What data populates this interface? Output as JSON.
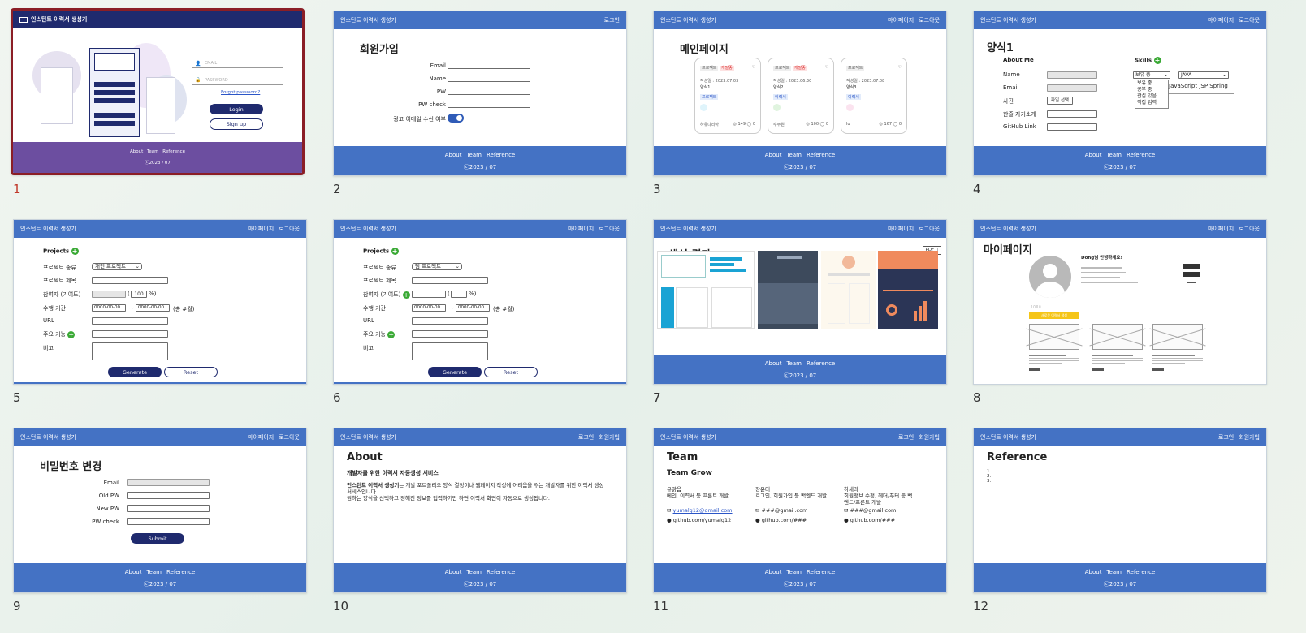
{
  "common": {
    "app_title": "인스턴트 이력서 생성기",
    "nav_mypage": "마이페이지",
    "nav_logout": "로그아웃",
    "nav_login": "로그인",
    "nav_signup": "회원가입",
    "footer_about": "About",
    "footer_team": "Team",
    "footer_reference": "Reference",
    "footer_copy": "ⓒ2023 / 07"
  },
  "slide_numbers": [
    "1",
    "2",
    "3",
    "4",
    "5",
    "6",
    "7",
    "8",
    "9",
    "10",
    "11",
    "12"
  ],
  "s1": {
    "email_placeholder": "EMAIL",
    "password_placeholder": "PASSWORD",
    "forgot": "Forgot password?",
    "login": "Login",
    "signup": "Sign up"
  },
  "s2": {
    "title": "회원가입",
    "email": "Email",
    "name": "Name",
    "pw": "PW",
    "pw_check": "PW check",
    "ad_consent": "광고 이메일 수신 여부"
  },
  "s3": {
    "title": "메인페이지",
    "cards": [
      {
        "tag1": "프로젝트",
        "tag2": "개발중",
        "date": "작성일 : 2023.07.03",
        "name": "양식1",
        "label": "프로젝트",
        "user": "하유나리아",
        "stats": "◎ 149  ◯ 0"
      },
      {
        "tag1": "프로젝트",
        "tag2": "개발중",
        "date": "작성일 : 2023.06.30",
        "name": "양식2",
        "label": "이력서",
        "user": "수주원",
        "stats": "◎ 100  ◯ 0"
      },
      {
        "tag1": "프로젝트",
        "tag2": "",
        "date": "작성일 : 2023.07.08",
        "name": "양식3",
        "label": "이력서",
        "user": "lu",
        "stats": "◎ 167  ◯ 0"
      }
    ]
  },
  "s4": {
    "title": "양식1",
    "about_me": "About Me",
    "skills": "Skills",
    "name": "Name",
    "email": "Email",
    "photo": "사진",
    "photo_button": "파일 선택",
    "intro": "한줄 자기소개",
    "github": "GitHub Link",
    "skill_select": "보유 중",
    "skill_options": [
      "보유 중",
      "공부 중",
      "관심 있음",
      "직접 입력"
    ],
    "lang_select": "JAVA",
    "skill_list": "JavaScript  JSP  Spring"
  },
  "s5": {
    "projects": "Projects",
    "type": "프로젝트 종류",
    "type_value": "개인 프로젝트",
    "name": "프로젝트 제목",
    "participants": "참여자 (기여도)",
    "percent_value": "100",
    "percent_unit": "%)",
    "period": "수행 기간",
    "date_ph": "0000-00-00",
    "tilde": "~",
    "months": "(총 #월)",
    "url": "URL",
    "features": "주요 기능",
    "note": "비고",
    "generate": "Generate",
    "reset": "Reset"
  },
  "s6": {
    "type_value": "팀 프로젝트"
  },
  "s7": {
    "title": "생성 결과",
    "pdf": "PDF"
  },
  "s8": {
    "title": "마이페이지",
    "greeting": "Dong님 안녕하세요!",
    "yellow_btn": "새로운 이력서 생성"
  },
  "s9": {
    "title": "비밀번호 변경",
    "email": "Email",
    "old_pw": "Old PW",
    "new_pw": "New PW",
    "pw_check": "PW check",
    "submit": "Submit"
  },
  "s10": {
    "title": "About",
    "subtitle": "개발자를 위한 이력서 자동생성 서비스",
    "body_bold": "인스턴트 이력서 생성기",
    "body1": "는 개발 포트폴리오 양식 결정이나 웹페이지 작성에 어려움을 겪는 개발자를 위한 이력서 생성 서비스입니다.",
    "body2": "원하는 양식을 선택하고 정해진 정보를 입력하기만 하면 이력서 화면이 자동으로 생성됩니다."
  },
  "s11": {
    "title": "Team",
    "subtitle": "Team Grow",
    "members": [
      {
        "name": "유맑음",
        "role": "메인, 이력서 등 프론트 개발",
        "email": "yumalg12@gmail.com",
        "github": "github.com/yumalg12"
      },
      {
        "name": "장윤태",
        "role": "로그인, 회원가입 등 백엔드 개발",
        "email": "###@gmail.com",
        "github": "github.com/###"
      },
      {
        "name": "하세라",
        "role": "회원정보 수정, 헤더/푸터 등 백엔드/프론트 개발",
        "email": "###@gmail.com",
        "github": "github.com/###"
      }
    ]
  },
  "s12": {
    "title": "Reference",
    "items": [
      "1.",
      "2.",
      "3."
    ]
  }
}
